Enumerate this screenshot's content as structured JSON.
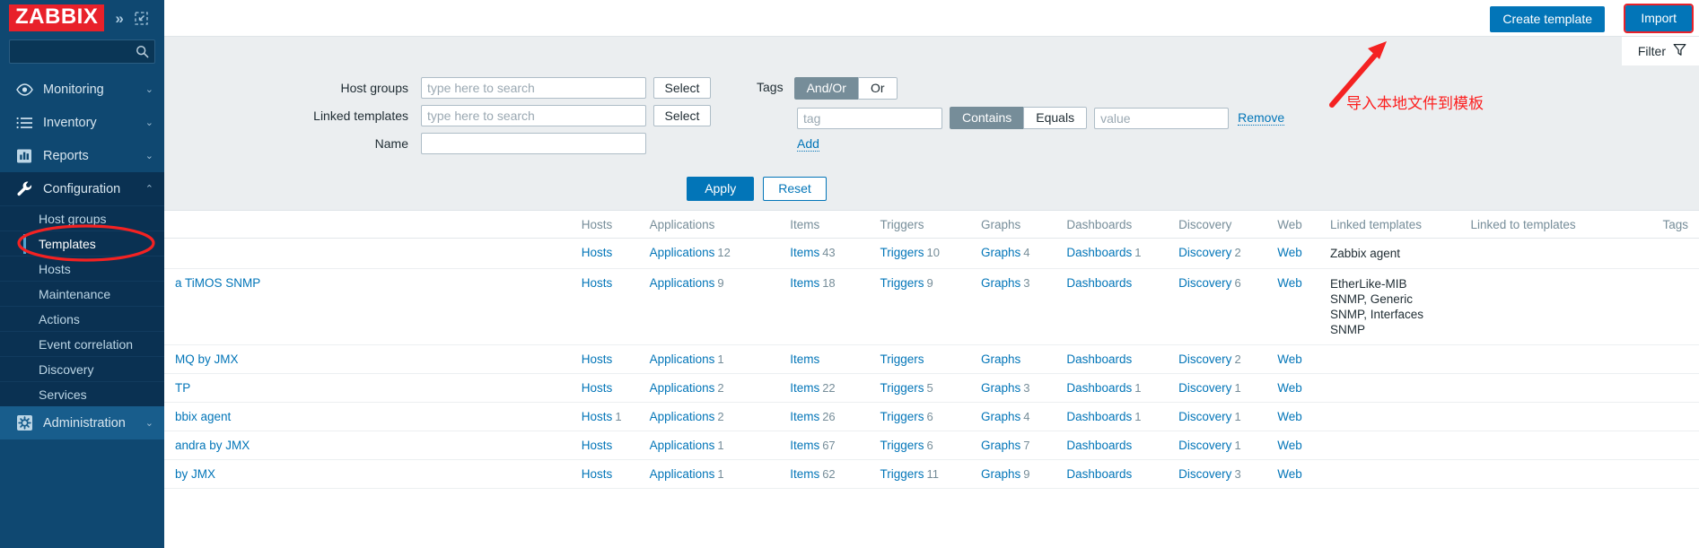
{
  "branding": {
    "logo_text": "ZABBIX"
  },
  "sidebar": {
    "collapse_icon": "chevron-double-right-icon",
    "compact_icon": "collapse-view-icon",
    "search": {
      "value": "",
      "placeholder": ""
    },
    "items": [
      {
        "label": "Monitoring",
        "icon": "eye-icon",
        "expandable": true
      },
      {
        "label": "Inventory",
        "icon": "list-icon",
        "expandable": true
      },
      {
        "label": "Reports",
        "icon": "bar-chart-icon",
        "expandable": true
      },
      {
        "label": "Configuration",
        "icon": "wrench-icon",
        "expandable": true,
        "active": true
      },
      {
        "label": "Administration",
        "icon": "gear-icon",
        "expandable": true
      }
    ],
    "configuration_sub": [
      {
        "label": "Host groups"
      },
      {
        "label": "Templates",
        "selected": true
      },
      {
        "label": "Hosts"
      },
      {
        "label": "Maintenance"
      },
      {
        "label": "Actions"
      },
      {
        "label": "Event correlation"
      },
      {
        "label": "Discovery"
      },
      {
        "label": "Services"
      }
    ]
  },
  "toolbar": {
    "create_template_label": "Create template",
    "import_label": "Import"
  },
  "filter": {
    "tab_label": "Filter",
    "funnel_icon": "funnel-icon",
    "host_groups_label": "Host groups",
    "host_groups_value": "",
    "host_groups_placeholder": "type here to search",
    "linked_templates_label": "Linked templates",
    "linked_templates_value": "",
    "linked_templates_placeholder": "type here to search",
    "name_label": "Name",
    "name_value": "",
    "select_label_1": "Select",
    "select_label_2": "Select",
    "tags_label": "Tags",
    "tag_operator_andor": "And/Or",
    "tag_operator_or": "Or",
    "tag_operator_selected": "And/Or",
    "tag_value": "",
    "tag_placeholder": "tag",
    "match_contains": "Contains",
    "match_equals": "Equals",
    "match_selected": "Contains",
    "value_value": "",
    "value_placeholder": "value",
    "remove_label": "Remove",
    "add_label": "Add",
    "apply_label": "Apply",
    "reset_label": "Reset"
  },
  "table": {
    "headers": {
      "name": "",
      "hosts": "Hosts",
      "applications": "Applications",
      "items": "Items",
      "triggers": "Triggers",
      "graphs": "Graphs",
      "dashboards": "Dashboards",
      "discovery": "Discovery",
      "web": "Web",
      "linked_templates": "Linked templates",
      "linked_to_templates": "Linked to templates",
      "tags": "Tags"
    },
    "rows": [
      {
        "name": "",
        "hosts": "Hosts",
        "hosts_count": "",
        "applications": "Applications",
        "applications_count": "12",
        "items": "Items",
        "items_count": "43",
        "triggers": "Triggers",
        "triggers_count": "10",
        "graphs": "Graphs",
        "graphs_count": "4",
        "dashboards": "Dashboards",
        "dashboards_count": "1",
        "discovery": "Discovery",
        "discovery_count": "2",
        "web": "Web",
        "linked_templates": [
          "Zabbix agent"
        ],
        "linked_to_templates": "",
        "tags": ""
      },
      {
        "name": "a TiMOS SNMP",
        "hosts": "Hosts",
        "hosts_count": "",
        "applications": "Applications",
        "applications_count": "9",
        "items": "Items",
        "items_count": "18",
        "triggers": "Triggers",
        "triggers_count": "9",
        "graphs": "Graphs",
        "graphs_count": "3",
        "dashboards": "Dashboards",
        "dashboards_count": "",
        "discovery": "Discovery",
        "discovery_count": "6",
        "web": "Web",
        "linked_templates": [
          "EtherLike-MIB",
          "SNMP, Generic",
          "SNMP, Interfaces",
          "SNMP"
        ],
        "linked_to_templates": "",
        "tags": ""
      },
      {
        "name": "MQ by JMX",
        "hosts": "Hosts",
        "hosts_count": "",
        "applications": "Applications",
        "applications_count": "1",
        "items": "Items",
        "items_count": "",
        "triggers": "Triggers",
        "triggers_count": "",
        "graphs": "Graphs",
        "graphs_count": "",
        "dashboards": "Dashboards",
        "dashboards_count": "",
        "discovery": "Discovery",
        "discovery_count": "2",
        "web": "Web",
        "linked_templates": [],
        "linked_to_templates": "",
        "tags": ""
      },
      {
        "name": "TP",
        "hosts": "Hosts",
        "hosts_count": "",
        "applications": "Applications",
        "applications_count": "2",
        "items": "Items",
        "items_count": "22",
        "triggers": "Triggers",
        "triggers_count": "5",
        "graphs": "Graphs",
        "graphs_count": "3",
        "dashboards": "Dashboards",
        "dashboards_count": "1",
        "discovery": "Discovery",
        "discovery_count": "1",
        "web": "Web",
        "linked_templates": [],
        "linked_to_templates": "",
        "tags": ""
      },
      {
        "name": "bbix agent",
        "hosts": "Hosts",
        "hosts_count": "1",
        "applications": "Applications",
        "applications_count": "2",
        "items": "Items",
        "items_count": "26",
        "triggers": "Triggers",
        "triggers_count": "6",
        "graphs": "Graphs",
        "graphs_count": "4",
        "dashboards": "Dashboards",
        "dashboards_count": "1",
        "discovery": "Discovery",
        "discovery_count": "1",
        "web": "Web",
        "linked_templates": [],
        "linked_to_templates": "",
        "tags": ""
      },
      {
        "name": "andra by JMX",
        "hosts": "Hosts",
        "hosts_count": "",
        "applications": "Applications",
        "applications_count": "1",
        "items": "Items",
        "items_count": "67",
        "triggers": "Triggers",
        "triggers_count": "6",
        "graphs": "Graphs",
        "graphs_count": "7",
        "dashboards": "Dashboards",
        "dashboards_count": "",
        "discovery": "Discovery",
        "discovery_count": "1",
        "web": "Web",
        "linked_templates": [],
        "linked_to_templates": "",
        "tags": ""
      },
      {
        "name": " by JMX",
        "hosts": "Hosts",
        "hosts_count": "",
        "applications": "Applications",
        "applications_count": "1",
        "items": "Items",
        "items_count": "62",
        "triggers": "Triggers",
        "triggers_count": "11",
        "graphs": "Graphs",
        "graphs_count": "9",
        "dashboards": "Dashboards",
        "dashboards_count": "",
        "discovery": "Discovery",
        "discovery_count": "3",
        "web": "Web",
        "linked_templates": [],
        "linked_to_templates": "",
        "tags": ""
      }
    ]
  },
  "annotations": {
    "chinese_note": "导入本地文件到模板",
    "note_color": "#fc1f1f",
    "arrow": "arrow-pointing-to-import-button",
    "ellipse": "ellipse-around-templates-menu-item"
  }
}
